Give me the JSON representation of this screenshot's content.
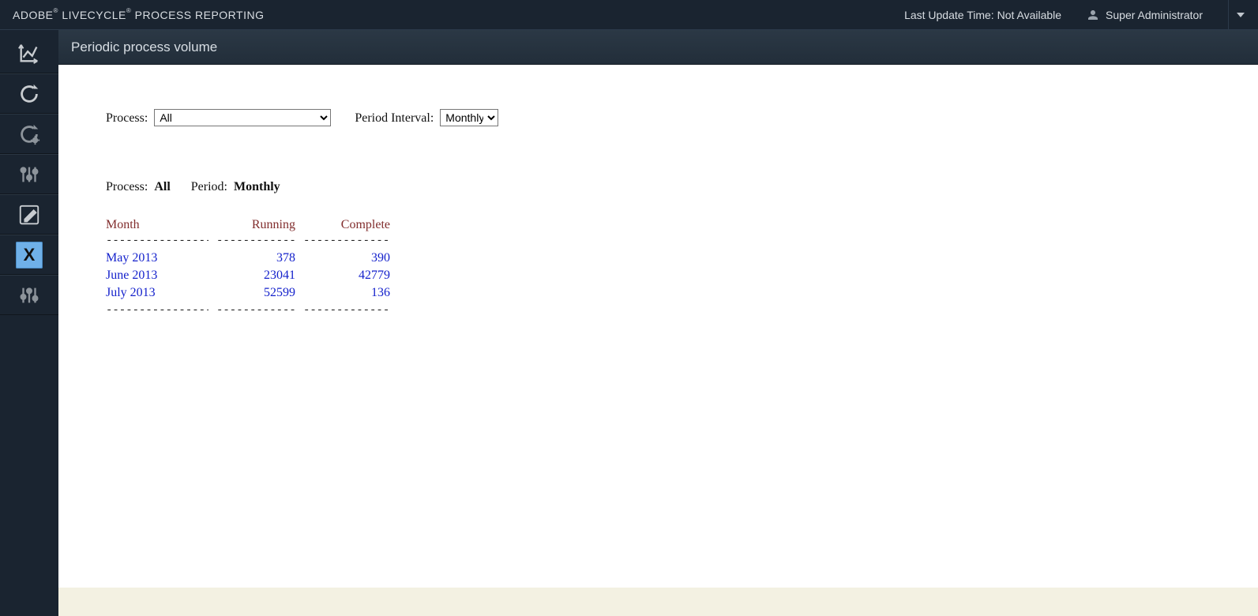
{
  "header": {
    "brand_part1": "ADOBE",
    "brand_part2": "LIVECYCLE",
    "brand_part3": "PROCESS REPORTING",
    "last_update_label": "Last Update Time:",
    "last_update_value": "Not Available",
    "user_name": "Super Administrator"
  },
  "section": {
    "title": "Periodic process volume"
  },
  "filters": {
    "process_label": "Process:",
    "process_value": "All",
    "period_label": "Period Interval:",
    "period_value": "Monthly"
  },
  "summary": {
    "process_label": "Process:",
    "process_value": "All",
    "period_label": "Period:",
    "period_value": "Monthly"
  },
  "table": {
    "headers": {
      "month": "Month",
      "running": "Running",
      "complete": "Complete"
    },
    "rows": [
      {
        "month": "May 2013",
        "running": "378",
        "complete": "390"
      },
      {
        "month": "June 2013",
        "running": "23041",
        "complete": "42779"
      },
      {
        "month": "July 2013",
        "running": "52599",
        "complete": "136"
      }
    ],
    "dashes": "------------------"
  },
  "sidebar": {
    "items": [
      {
        "name": "chart-icon"
      },
      {
        "name": "refresh-icon"
      },
      {
        "name": "refresh-settings-icon"
      },
      {
        "name": "sliders-icon"
      },
      {
        "name": "edit-icon"
      },
      {
        "name": "close-icon",
        "selected": true
      },
      {
        "name": "sliders2-icon"
      }
    ]
  },
  "chart_data": {
    "type": "table",
    "title": "Periodic process volume",
    "categories": [
      "May 2013",
      "June 2013",
      "July 2013"
    ],
    "series": [
      {
        "name": "Running",
        "values": [
          378,
          23041,
          52599
        ]
      },
      {
        "name": "Complete",
        "values": [
          390,
          42779,
          136
        ]
      }
    ]
  }
}
